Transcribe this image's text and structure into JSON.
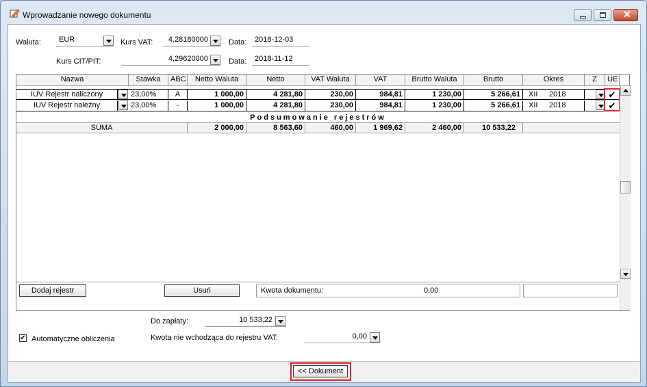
{
  "window": {
    "title": "Wprowadzanie nowego dokumentu"
  },
  "header": {
    "waluta_label": "Waluta:",
    "waluta_value": "EUR",
    "kurs_vat_label": "Kurs VAT:",
    "kurs_vat_value": "4,28180000",
    "data1_label": "Data:",
    "data1_value": "2018-12-03",
    "kurs_cit_label": "Kurs CIT/PIT:",
    "kurs_cit_value": "4,29620000",
    "data2_label": "Data:",
    "data2_value": "2018-11-12"
  },
  "grid": {
    "columns": [
      "Nazwa",
      "Stawka",
      "ABC",
      "Netto Waluta",
      "Netto",
      "VAT Waluta",
      "VAT",
      "Brutto Waluta",
      "Brutto",
      "Okres",
      "Z",
      "UE"
    ],
    "rows": [
      {
        "nazwa": "IUV Rejestr naliczony",
        "stawka": "23,00%",
        "abc": "A",
        "netto_waluta": "1 000,00",
        "netto": "4 281,80",
        "vat_waluta": "230,00",
        "vat": "984,81",
        "brutto_waluta": "1 230,00",
        "brutto": "5 266,61",
        "okres_m": "XII",
        "okres_y": "2018"
      },
      {
        "nazwa": "IUV Rejestr należny",
        "stawka": "23,00%",
        "abc": "-",
        "netto_waluta": "1 000,00",
        "netto": "4 281,80",
        "vat_waluta": "230,00",
        "vat": "984,81",
        "brutto_waluta": "1 230,00",
        "brutto": "5 266,61",
        "okres_m": "XII",
        "okres_y": "2018"
      }
    ],
    "summary_title": "Podsumowanie rejestrów",
    "sum": {
      "label": "SUMA",
      "netto_waluta": "2 000,00",
      "netto": "8 563,60",
      "vat_waluta": "460,00",
      "vat": "1 969,62",
      "brutto_waluta": "2 460,00",
      "brutto": "10 533,22"
    }
  },
  "bottom": {
    "add_button": "Dodaj rejestr",
    "remove_button": "Usuń",
    "kwota_label": "Kwota dokumentu:",
    "kwota_value": "0,00"
  },
  "payment": {
    "do_zaplaty_label": "Do zapłaty:",
    "do_zaplaty_value": "10 533,22",
    "auto_label": "Automatyczne obliczenia",
    "kwota_nie_label": "Kwota nie wchodząca do rejestru VAT:",
    "kwota_nie_value": "0,00"
  },
  "footer": {
    "dokument_button": "<< Dokument"
  }
}
